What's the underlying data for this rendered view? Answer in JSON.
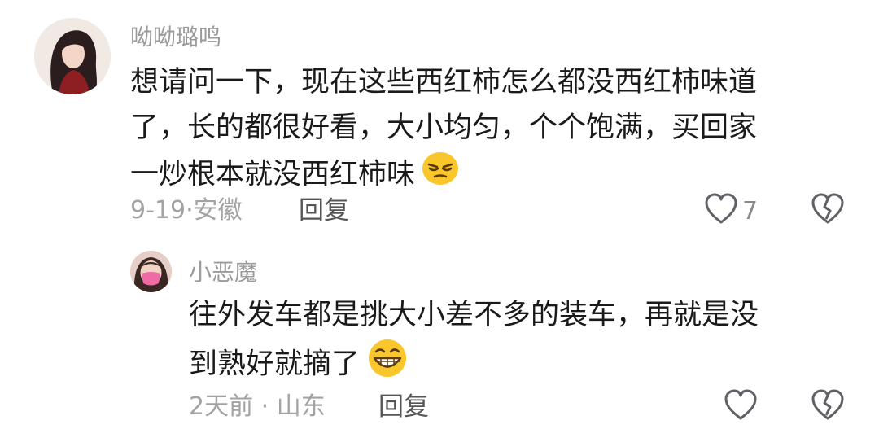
{
  "comment": {
    "author": "呦呦璐鸣",
    "lines": [
      "想请问一下，现在这些西红柿怎么都没西红柿味道",
      "了，长的都很好看，大小均匀，个个饱满，买回家",
      "一炒根本就没西红柿味"
    ],
    "emoji": "squint-face-emoji",
    "date": "9-19",
    "location": "安徽",
    "separator": "·",
    "reply_label": "回复",
    "like_count": "7"
  },
  "reply": {
    "author": "小恶魔",
    "lines": [
      "往外发车都是挑大小差不多的装车，再就是没",
      "到熟好就摘了"
    ],
    "emoji": "grinning-face-emoji",
    "date": "2天前",
    "location": "山东",
    "separator": "·",
    "reply_label": "回复"
  },
  "icons": {
    "like": "heart-outline-icon",
    "dislike": "broken-heart-icon"
  }
}
